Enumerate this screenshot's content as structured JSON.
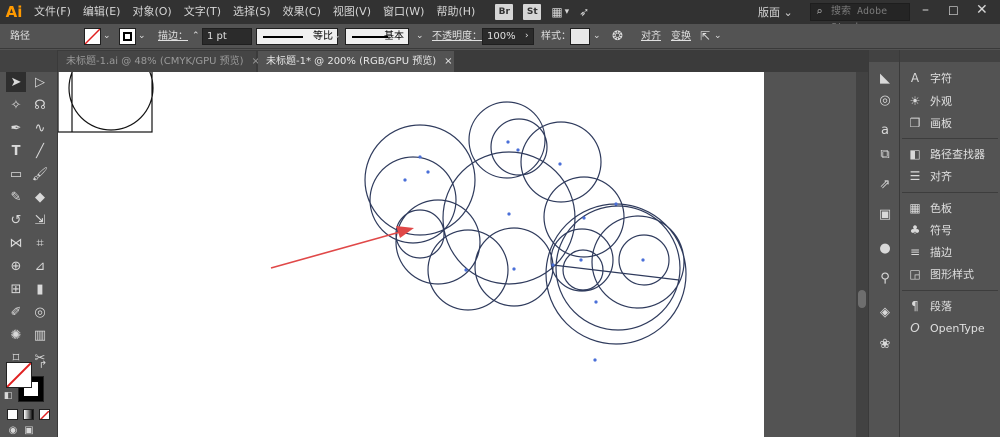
{
  "menubar": {
    "logo": "Ai",
    "items": [
      "文件(F)",
      "编辑(E)",
      "对象(O)",
      "文字(T)",
      "选择(S)",
      "效果(C)",
      "视图(V)",
      "窗口(W)",
      "帮助(H)"
    ],
    "badge_br": "Br",
    "badge_st": "St",
    "workspace": "版面",
    "search_placeholder": "搜索 Adobe Stock"
  },
  "controlbar": {
    "selection_label": "路径",
    "stroke_label": "描边：",
    "stroke_weight": "1 pt",
    "profile_label": "等比",
    "brush_label": "基本",
    "opacity_label": "不透明度：",
    "opacity_value": "100%",
    "style_label": "样式：",
    "align_label": "对齐",
    "transform_label": "变换"
  },
  "tabs": [
    {
      "label": "未标题-1.ai @ 48% (CMYK/GPU 预览)",
      "close": "×"
    },
    {
      "label": "未标题-1* @ 200% (RGB/GPU 预览)",
      "close": "×"
    }
  ],
  "panels": {
    "items": [
      {
        "icon": "A",
        "label": "字符"
      },
      {
        "icon": "☀",
        "label": "外观"
      },
      {
        "icon": "❐",
        "label": "画板"
      },
      {
        "icon": "◧",
        "label": "路径查找器"
      },
      {
        "icon": "☰",
        "label": "对齐"
      },
      {
        "icon": "▦",
        "label": "色板"
      },
      {
        "icon": "♣",
        "label": "符号"
      },
      {
        "icon": "≡",
        "label": "描边"
      },
      {
        "icon": "◲",
        "label": "图形样式"
      },
      {
        "icon": "¶",
        "label": "段落"
      },
      {
        "icon": "O",
        "label": "OpenType"
      }
    ]
  },
  "colors": {
    "ui_dark": "#323232",
    "ui_mid": "#535353",
    "path_stroke": "#2e3a5c",
    "anchor": "#4a6fd8",
    "arrow": "#e04848",
    "brand": "#ff9a00"
  }
}
